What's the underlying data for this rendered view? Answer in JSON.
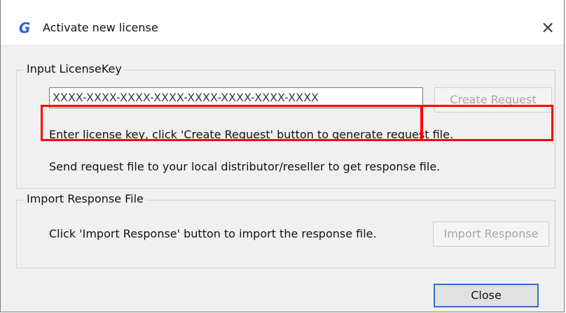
{
  "window": {
    "title": "Activate new license",
    "close_glyph": "×",
    "app_icon": "G"
  },
  "input_group": {
    "label": "Input LicenseKey",
    "license_key_value": "XXXX-XXXX-XXXX-XXXX-XXXX-XXXX-XXXX-XXXX",
    "create_request_label": "Create Request",
    "instruction_1": "Enter license key, click 'Create Request' button to generate request file.",
    "instruction_2": "Send request file to your local distributor/reseller to get response file."
  },
  "import_group": {
    "label": "Import Response File",
    "instruction": "Click 'Import Response' button to import the response file.",
    "import_response_label": "Import Response"
  },
  "footer": {
    "close_label": "Close"
  },
  "colors": {
    "highlight": "#ff0000",
    "app_icon": "#2f5fd0",
    "close_border": "#2f6fd0"
  }
}
